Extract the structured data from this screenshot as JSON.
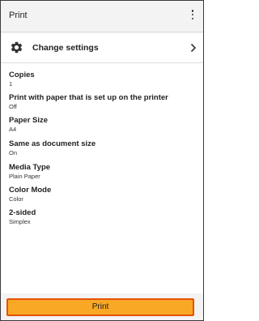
{
  "app_bar": {
    "title": "Print",
    "menu_icon": "overflow-menu-icon"
  },
  "change_settings": {
    "label": "Change settings",
    "icon": "gear-icon",
    "trailing_icon": "chevron-right-icon"
  },
  "settings": [
    {
      "name": "Copies",
      "value": "1"
    },
    {
      "name": "Print with paper that is set up on the printer",
      "value": "Off"
    },
    {
      "name": "Paper Size",
      "value": "A4"
    },
    {
      "name": "Same as document size",
      "value": "On"
    },
    {
      "name": "Media Type",
      "value": "Plain Paper"
    },
    {
      "name": "Color Mode",
      "value": "Color"
    },
    {
      "name": "2-sided",
      "value": "Simplex"
    }
  ],
  "print_button": {
    "label": "Print",
    "fill_color": "#f9a825",
    "border_color": "#e65100"
  }
}
